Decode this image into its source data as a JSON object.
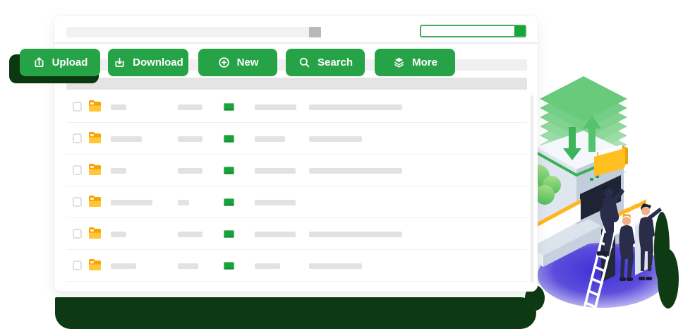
{
  "topbar": {
    "address_bar": {
      "value": "",
      "placeholder": ""
    },
    "progress_bar": {
      "percent": 100
    }
  },
  "toolbar": {
    "buttons": [
      {
        "label": "Upload",
        "icon": "upload-icon"
      },
      {
        "label": "Download",
        "icon": "download-icon"
      },
      {
        "label": "New",
        "icon": "plus-circle-icon"
      },
      {
        "label": "Search",
        "icon": "search-icon"
      },
      {
        "label": "More",
        "icon": "layers-icon"
      }
    ]
  },
  "table": {
    "header": "placeholder-bar",
    "rows": [
      {
        "checked": false,
        "icon": "folder-icon",
        "badge": true,
        "bars": [
          22,
          35,
          59,
          132
        ]
      },
      {
        "checked": false,
        "icon": "folder-icon",
        "badge": true,
        "bars": [
          44,
          35,
          43,
          75
        ]
      },
      {
        "checked": false,
        "icon": "folder-icon",
        "badge": true,
        "bars": [
          22,
          35,
          58,
          132
        ]
      },
      {
        "checked": false,
        "icon": "folder-icon",
        "badge": true,
        "bars": [
          59,
          16,
          58,
          0
        ]
      },
      {
        "checked": false,
        "icon": "folder-icon",
        "badge": true,
        "bars": [
          22,
          35,
          58,
          132
        ]
      },
      {
        "checked": false,
        "icon": "folder-icon",
        "badge": true,
        "bars": [
          36,
          29,
          36,
          75
        ]
      }
    ]
  },
  "colors": {
    "accent_green": "#27A347",
    "dark_green": "#0D3A12",
    "badge_green": "#17A43A",
    "folder_yellow": "#FFC637",
    "folder_tab_orange": "#F7A300",
    "placeholder_gray": "#E2E2E2",
    "floor_purple": "#4333D8"
  },
  "illustration": {
    "elements": [
      "stacked-sheets-icon",
      "transfer-arrows-icon",
      "storage-cabinet",
      "yellow-folder-icon",
      "green-cloud-icon",
      "file-drawers",
      "ladder",
      "business-people",
      "purple-floor",
      "green-bushes"
    ]
  }
}
